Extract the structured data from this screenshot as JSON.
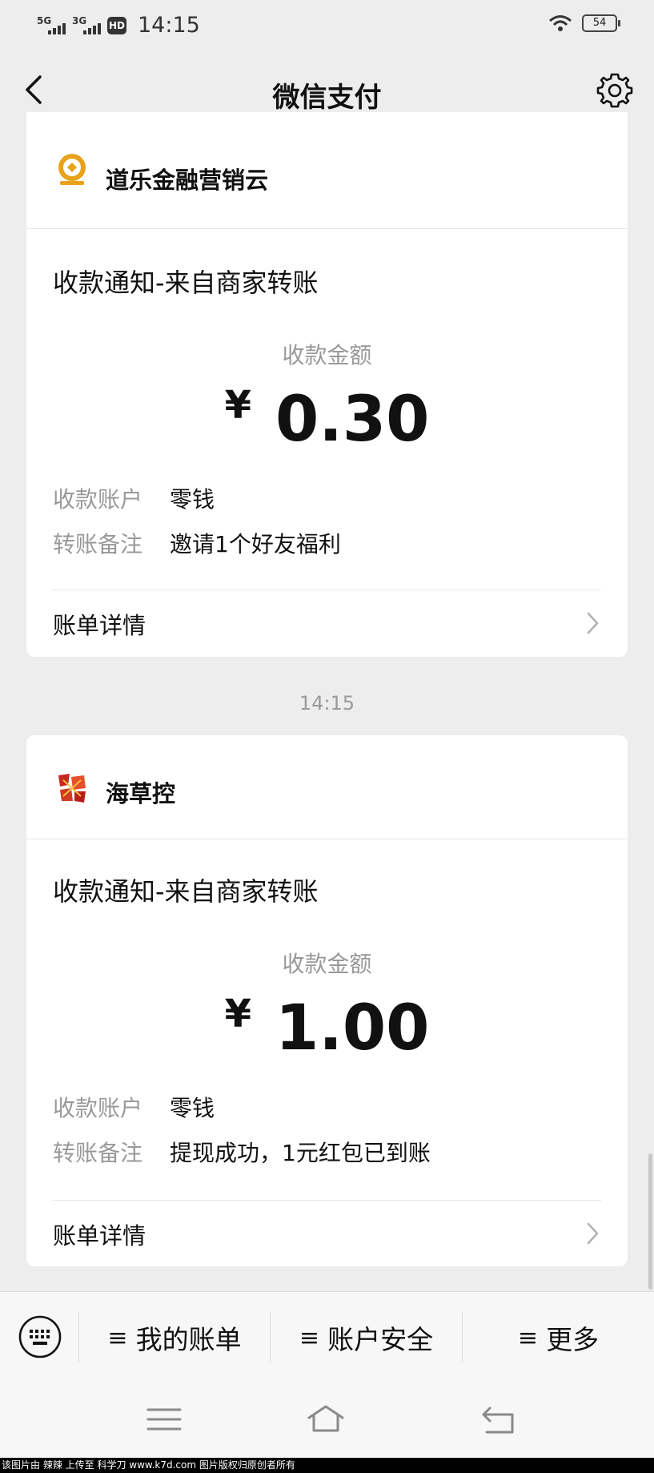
{
  "status_bar": {
    "net1": "5G",
    "net2": "3G",
    "hd": "HD",
    "time": "14:15",
    "battery": "54"
  },
  "nav": {
    "title": "微信支付"
  },
  "messages": [
    {
      "merchant": "道乐金融营销云",
      "title": "收款通知-来自商家转账",
      "amount_label": "收款金额",
      "currency": "¥",
      "amount": "0.30",
      "account_key": "收款账户",
      "account_value": "零钱",
      "remark_key": "转账备注",
      "remark_value": "邀请1个好友福利",
      "detail_label": "账单详情"
    },
    {
      "merchant": "海草控",
      "title": "收款通知-来自商家转账",
      "amount_label": "收款金额",
      "currency": "¥",
      "amount": "1.00",
      "account_key": "收款账户",
      "account_value": "零钱",
      "remark_key": "转账备注",
      "remark_value": "提现成功，1元红包已到账",
      "detail_label": "账单详情"
    }
  ],
  "time_separator": "14:15",
  "menu": {
    "items": [
      {
        "icon": "≡",
        "label": "我的账单"
      },
      {
        "icon": "≡",
        "label": "账户安全"
      },
      {
        "icon": "≡",
        "label": "更多"
      }
    ]
  },
  "watermark": "该图片由 辣辣 上传至 科学刀 www.k7d.com 图片版权归原创者所有",
  "colors": {
    "background": "#ededed",
    "card": "#ffffff",
    "muted_text": "#999999",
    "logo_gold": "#e8a21a",
    "logo_red": "#c8261f"
  },
  "icons": [
    "back-arrow-icon",
    "gear-icon",
    "wifi-icon",
    "battery-icon",
    "keyboard-icon",
    "chevron-right-icon",
    "menu-lines-icon",
    "home-icon",
    "return-icon"
  ]
}
